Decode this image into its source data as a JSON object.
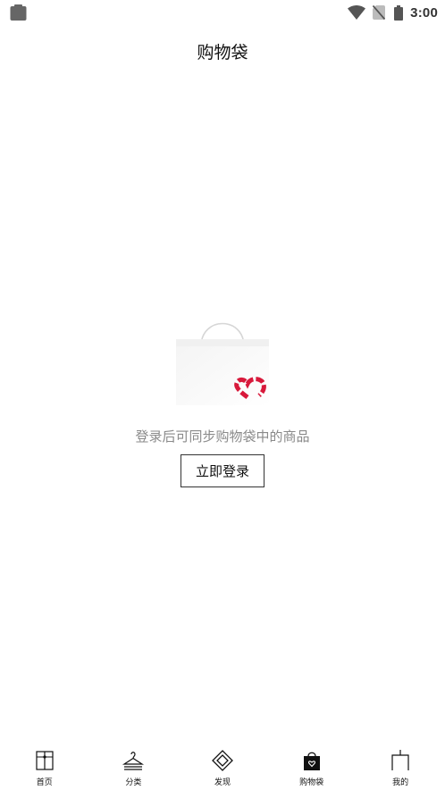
{
  "status_bar": {
    "time": "3:00",
    "icons": [
      "app-notification-icon",
      "wifi-icon",
      "no-sim-icon",
      "battery-icon"
    ]
  },
  "header": {
    "title": "购物袋"
  },
  "empty_state": {
    "illustration": "shopping-bag-heart-icon",
    "message": "登录后可同步购物袋中的商品",
    "login_button_label": "立即登录",
    "accent_color": "#d8193b"
  },
  "bottom_nav": {
    "items": [
      {
        "label": "首页",
        "icon": "gift-box-icon",
        "active": false
      },
      {
        "label": "分类",
        "icon": "hanger-icon",
        "active": false
      },
      {
        "label": "发现",
        "icon": "diamond-icon",
        "active": false
      },
      {
        "label": "购物袋",
        "icon": "shopping-bag-icon",
        "active": true
      },
      {
        "label": "我的",
        "icon": "profile-door-icon",
        "active": false
      }
    ]
  }
}
